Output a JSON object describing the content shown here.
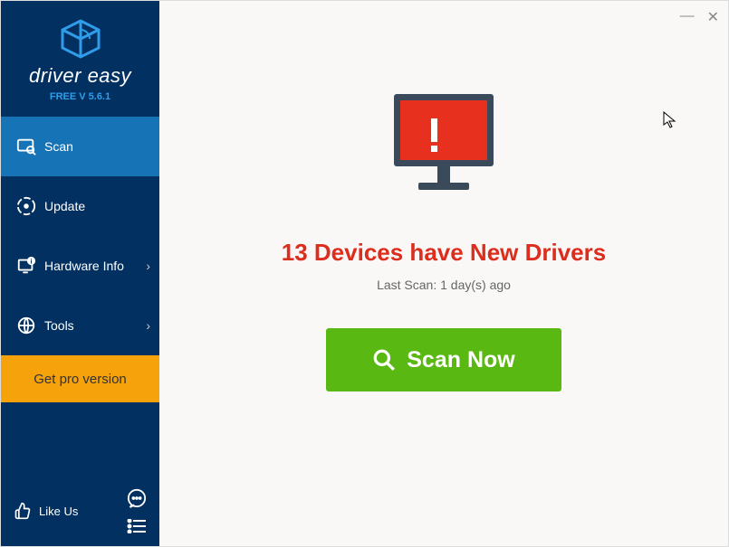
{
  "app": {
    "name": "driver easy",
    "version_label": "FREE V 5.6.1"
  },
  "sidebar": {
    "items": [
      {
        "label": "Scan",
        "icon": "scan-icon",
        "has_sub": false,
        "active": true
      },
      {
        "label": "Update",
        "icon": "update-icon",
        "has_sub": false,
        "active": false
      },
      {
        "label": "Hardware Info",
        "icon": "hardware-icon",
        "has_sub": true,
        "active": false
      },
      {
        "label": "Tools",
        "icon": "tools-icon",
        "has_sub": true,
        "active": false
      }
    ],
    "pro_button": "Get pro version",
    "like_label": "Like Us"
  },
  "main": {
    "headline": "13 Devices have New Drivers",
    "last_scan": "Last Scan: 1 day(s) ago",
    "scan_button": "Scan Now"
  },
  "window": {
    "minimize": "—",
    "close": "✕"
  }
}
